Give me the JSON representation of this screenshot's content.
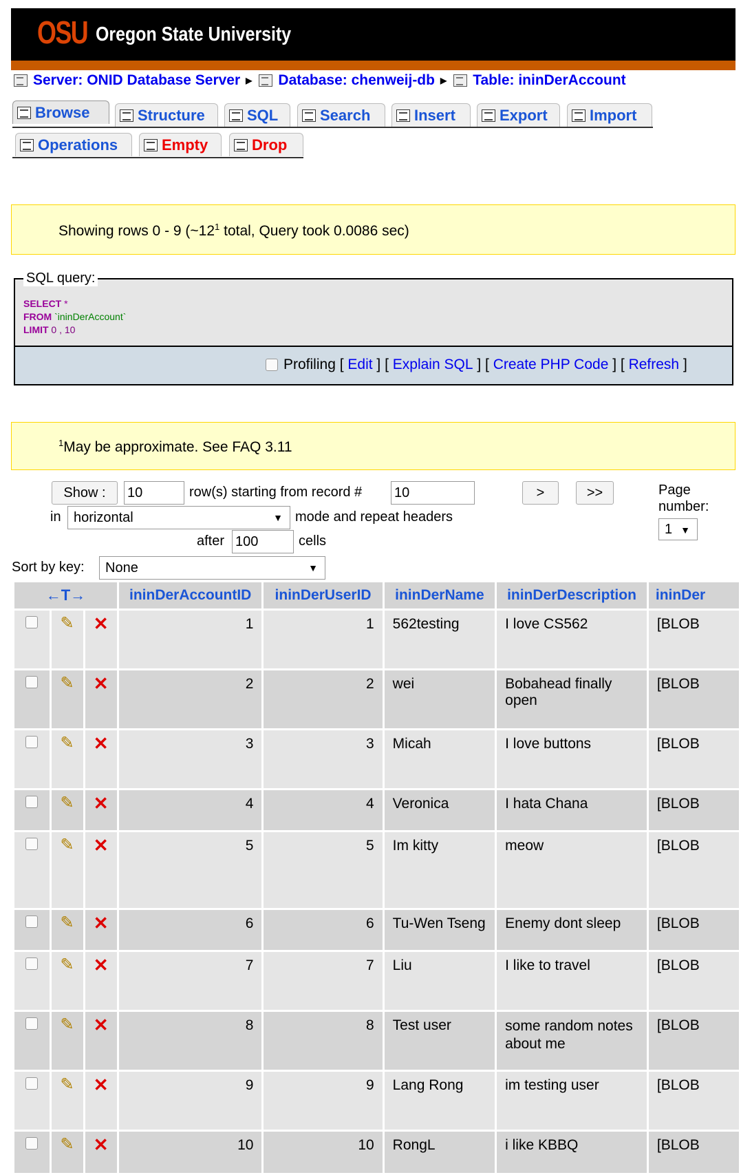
{
  "header": {
    "logo_mark": "OSU",
    "university": "Oregon State University"
  },
  "breadcrumb": {
    "server": "Server: ONID Database Server",
    "database": "Database: chenweij-db",
    "table": "Table: ininDerAccount"
  },
  "tabs": {
    "browse": "Browse",
    "structure": "Structure",
    "sql": "SQL",
    "search": "Search",
    "insert": "Insert",
    "export": "Export",
    "import": "Import",
    "operations": "Operations",
    "empty": "Empty",
    "drop": "Drop"
  },
  "notice": {
    "showing_prefix": "Showing rows 0 - 9 (~12",
    "showing_sup": "1",
    "showing_suffix": " total, Query took 0.0086 sec)"
  },
  "sql": {
    "legend": "SQL query:",
    "l1_kw": "SELECT",
    "l1_rest": " *",
    "l2_kw": "FROM",
    "l2_str": " `ininDerAccount`",
    "l3_kw": "LIMIT",
    "l3_num": " 0 , 10",
    "profiling": "Profiling",
    "edit": "Edit",
    "explain": "Explain SQL",
    "php": "Create PHP Code",
    "refresh": "Refresh"
  },
  "footnote": {
    "sup": "1",
    "text": "May be approximate. See FAQ 3.11"
  },
  "nav": {
    "show_button": "Show :",
    "rows_value": "10",
    "rows_label": "row(s) starting from record #",
    "start_value": "10",
    "in_label": "in",
    "mode_value": "horizontal",
    "mode_label": "mode and repeat headers",
    "after_label": "after",
    "after_value": "100",
    "cells_label": "cells",
    "next_button": ">",
    "last_button": ">>",
    "page_label_1": "Page",
    "page_label_2": "number:",
    "page_value": "1"
  },
  "sort": {
    "label": "Sort by key:",
    "value": "None"
  },
  "table": {
    "sort_handle": "←T→",
    "columns": [
      "ininDerAccountID",
      "ininDerUserID",
      "ininDerName",
      "ininDerDescription",
      "ininDer"
    ],
    "rows": [
      [
        "1",
        "1",
        "562testing",
        "I love CS562",
        "[BLOB"
      ],
      [
        "2",
        "2",
        "wei",
        "Bobahead finally open",
        "[BLOB"
      ],
      [
        "3",
        "3",
        "Micah",
        "I love buttons",
        "[BLOB"
      ],
      [
        "4",
        "4",
        "Veronica",
        "I hata Chana",
        "[BLOB"
      ],
      [
        "5",
        "5",
        "Im kitty",
        "meow",
        "[BLOB"
      ],
      [
        "6",
        "6",
        "Tu-Wen Tseng",
        "Enemy dont sleep",
        "[BLOB"
      ],
      [
        "7",
        "7",
        "Liu",
        "I like to travel",
        "[BLOB"
      ],
      [
        "8",
        "8",
        "Test user",
        "some random notes about me",
        "[BLOB"
      ],
      [
        "9",
        "9",
        "Lang Rong",
        "im testing user",
        "[BLOB"
      ],
      [
        "10",
        "10",
        "RongL",
        "i like KBBQ",
        "[BLOB"
      ]
    ]
  }
}
